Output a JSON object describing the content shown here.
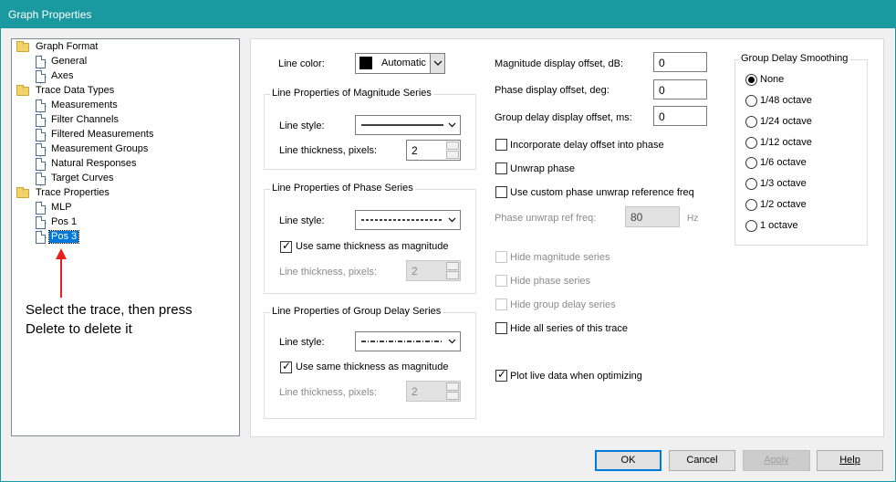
{
  "window": {
    "title": "Graph Properties"
  },
  "tree": {
    "graph_format": "Graph Format",
    "general": "General",
    "axes": "Axes",
    "trace_data_types": "Trace Data Types",
    "measurements": "Measurements",
    "filter_channels": "Filter Channels",
    "filtered_measurements": "Filtered Measurements",
    "measurement_groups": "Measurement Groups",
    "natural_responses": "Natural Responses",
    "target_curves": "Target Curves",
    "trace_properties": "Trace Properties",
    "mlp": "MLP",
    "pos1": "Pos 1",
    "pos3": "Pos 3"
  },
  "annotation": {
    "line1": "Select the trace, then press",
    "line2": "Delete to delete it"
  },
  "line_color": {
    "label": "Line color:",
    "value": "Automatic",
    "swatch": "#000000"
  },
  "magnitude_series": {
    "title": "Line Properties of Magnitude Series",
    "style_label": "Line style:",
    "thickness_label": "Line thickness, pixels:",
    "thickness_value": "2"
  },
  "phase_series": {
    "title": "Line Properties of Phase Series",
    "style_label": "Line style:",
    "same_thickness_label": "Use same thickness as magnitude",
    "thickness_label": "Line thickness, pixels:",
    "thickness_value": "2"
  },
  "group_delay_series": {
    "title": "Line Properties of Group Delay Series",
    "style_label": "Line style:",
    "same_thickness_label": "Use same thickness as magnitude",
    "thickness_label": "Line thickness, pixels:",
    "thickness_value": "2"
  },
  "offsets": {
    "magnitude_label": "Magnitude display offset, dB:",
    "magnitude_value": "0",
    "phase_label": "Phase display offset, deg:",
    "phase_value": "0",
    "group_delay_label": "Group delay display offset, ms:",
    "group_delay_value": "0"
  },
  "options": {
    "incorporate_delay": "Incorporate delay offset into phase",
    "unwrap_phase": "Unwrap phase",
    "custom_unwrap": "Use custom phase unwrap reference freq",
    "unwrap_ref_label": "Phase unwrap ref freq:",
    "unwrap_ref_value": "80",
    "unwrap_ref_unit": "Hz",
    "hide_magnitude": "Hide magnitude series",
    "hide_phase": "Hide phase series",
    "hide_group_delay": "Hide group delay series",
    "hide_all": "Hide all series of this trace",
    "plot_live": "Plot live data when optimizing"
  },
  "smoothing": {
    "title": "Group Delay Smoothing",
    "items": [
      "None",
      "1/48 octave",
      "1/24 octave",
      "1/12 octave",
      "1/6 octave",
      "1/3 octave",
      "1/2 octave",
      "1 octave"
    ],
    "selected": "None"
  },
  "buttons": {
    "ok": "OK",
    "cancel": "Cancel",
    "apply": "Apply",
    "help": "Help"
  }
}
